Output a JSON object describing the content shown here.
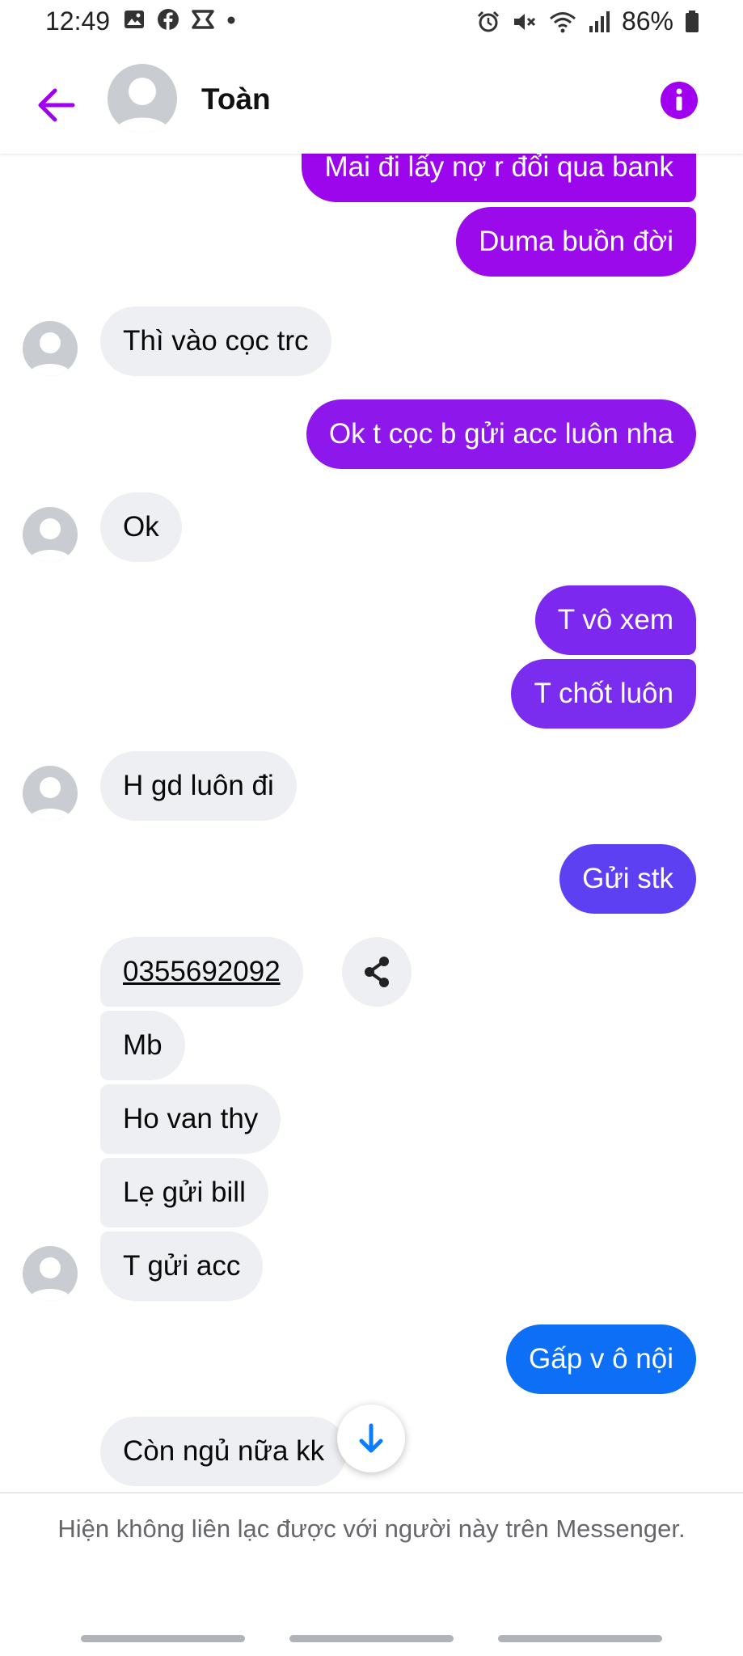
{
  "status_bar": {
    "time": "12:49",
    "battery": "86%",
    "left_icons": [
      "gallery-icon",
      "facebook-icon",
      "capcut-icon",
      "dot-icon"
    ],
    "right_icons": [
      "alarm-icon",
      "mute-icon",
      "wifi-icon",
      "signal-icon",
      "battery-icon"
    ]
  },
  "header": {
    "contact_name": "Toàn",
    "accent_color": "#a100f0"
  },
  "messages": [
    {
      "from": "me",
      "text": "Mai đi lấy nợ r đổi qua bank",
      "color": "#9b06ec"
    },
    {
      "from": "me",
      "text": "Duma buồn đời",
      "color": "#9a0aeb"
    },
    {
      "from": "them",
      "text": "Thì vào cọc trc"
    },
    {
      "from": "me",
      "text": "Ok t cọc b gửi acc luôn nha",
      "color": "#8e18ec"
    },
    {
      "from": "them",
      "text": "Ok"
    },
    {
      "from": "me",
      "text": "T vô xem",
      "color": "#7c28ef"
    },
    {
      "from": "me",
      "text": "T chốt luôn",
      "color": "#7a2cef"
    },
    {
      "from": "them",
      "text": "H gd luôn đi"
    },
    {
      "from": "me",
      "text": "Gửi stk",
      "color": "#5c40f2"
    },
    {
      "from": "them",
      "text": "0355692092"
    },
    {
      "from": "them",
      "text": "Mb"
    },
    {
      "from": "them",
      "text": "Ho van thy"
    },
    {
      "from": "them",
      "text": "Lẹ gửi bill"
    },
    {
      "from": "them",
      "text": "T gửi acc"
    },
    {
      "from": "me",
      "text": "Gấp v ô nội",
      "color": "#0c6ff5"
    },
    {
      "from": "them",
      "text": "Còn ngủ nữa kk"
    }
  ],
  "footer": {
    "notice": "Hiện không liên lạc được với người này trên Messenger."
  }
}
